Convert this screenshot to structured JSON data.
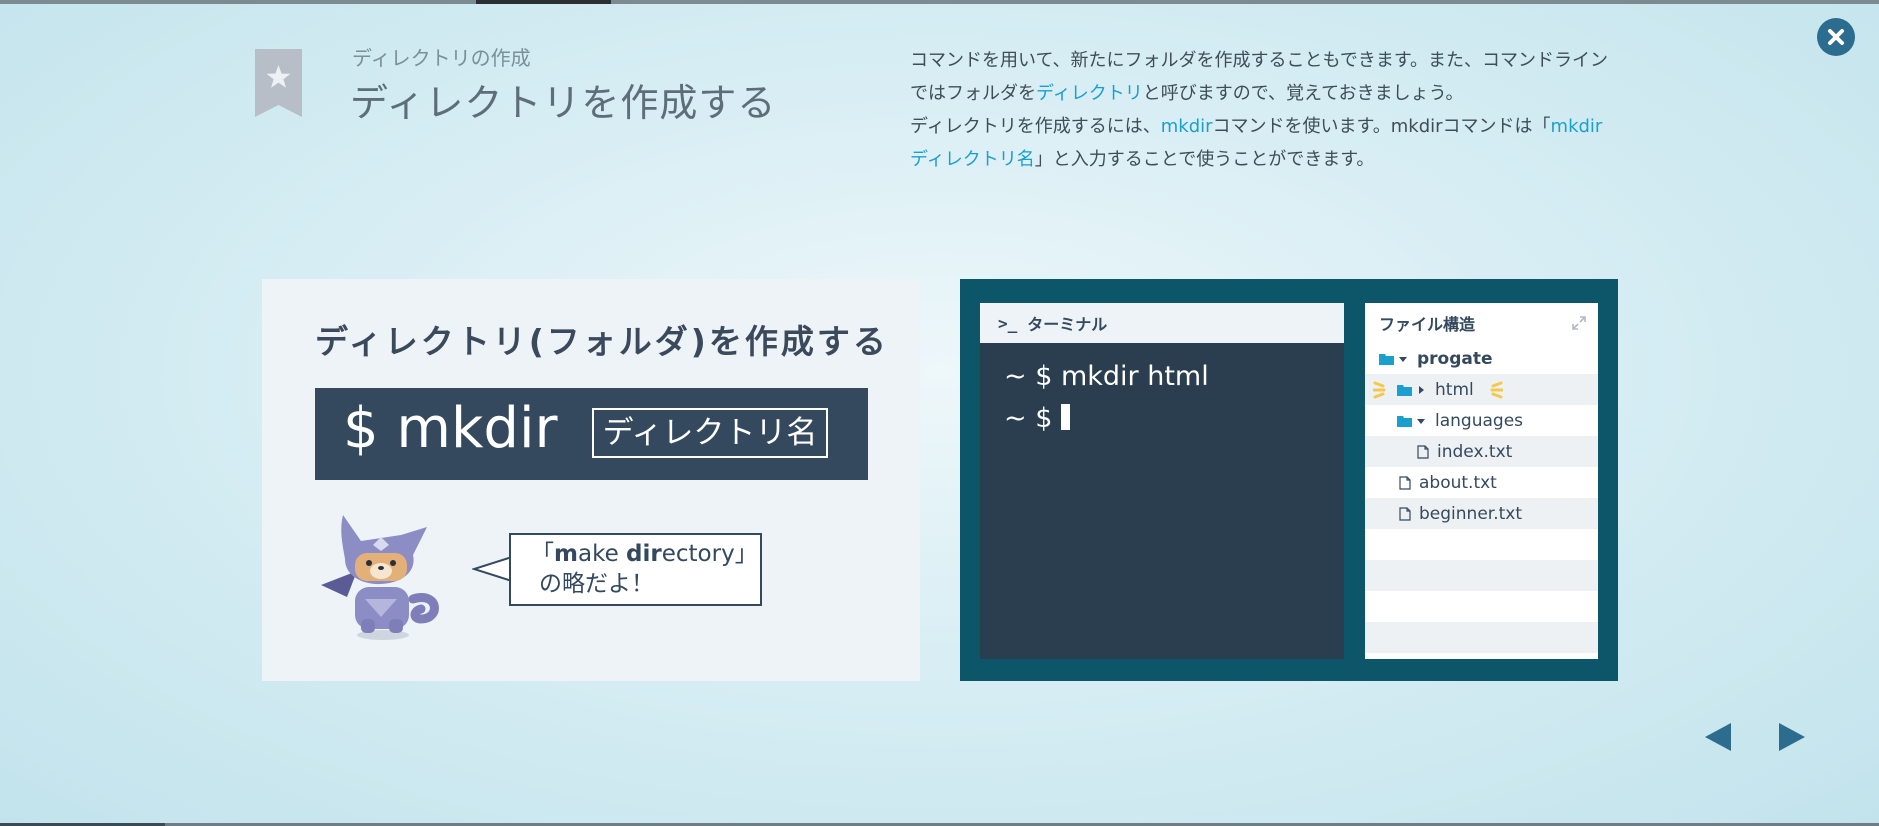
{
  "header": {
    "subtitle": "ディレクトリの作成",
    "title": "ディレクトリを作成する"
  },
  "description": {
    "p1_a": "コマンドを用いて、新たにフォルダを作成することもできます。また、コマンドラインではフォル",
    "p1_b": "ダを",
    "p1_link": "ディレクトリ",
    "p1_c": "と呼びますので、覚えておきましょう。",
    "p2_a": "ディレクトリを作成するには、",
    "p2_link1": "mkdir",
    "p2_b": "コマンドを使います。mkdirコマンドは「",
    "p2_link2a": "mkdir ディレク",
    "p2_link2b": "トリ名",
    "p2_c": "」と入力することで使うことができます。"
  },
  "slide_left": {
    "title": "ディレクトリ(フォルダ)を作成する",
    "command": "$ mkdir",
    "argument": "ディレクトリ名",
    "bubble_line1_pre": "「",
    "bubble_m": "m",
    "bubble_ake": "ake ",
    "bubble_dir": "dir",
    "bubble_rest": "ectory」",
    "bubble_line2": "の略だよ！"
  },
  "terminal": {
    "header": "ターミナル",
    "line1": "~ $ mkdir html",
    "line2": "~ $ "
  },
  "file_tree": {
    "header": "ファイル構造",
    "items": [
      {
        "name": "progate",
        "type": "folder",
        "open": true,
        "depth": 0
      },
      {
        "name": "html",
        "type": "folder",
        "open": false,
        "depth": 1,
        "highlight": true
      },
      {
        "name": "languages",
        "type": "folder",
        "open": true,
        "depth": 1
      },
      {
        "name": "index.txt",
        "type": "file",
        "depth": 2
      },
      {
        "name": "about.txt",
        "type": "file",
        "depth": 1
      },
      {
        "name": "beginner.txt",
        "type": "file",
        "depth": 1
      }
    ]
  },
  "icons": {
    "close": "close-icon",
    "prev": "prev-arrow-icon",
    "next": "next-arrow-icon",
    "bookmark": "star-bookmark-icon"
  },
  "colors": {
    "accent": "#1aa0cf",
    "dark": "#34495e",
    "terminal_bg": "#2b3e50",
    "panel_bg": "#0d5568"
  }
}
